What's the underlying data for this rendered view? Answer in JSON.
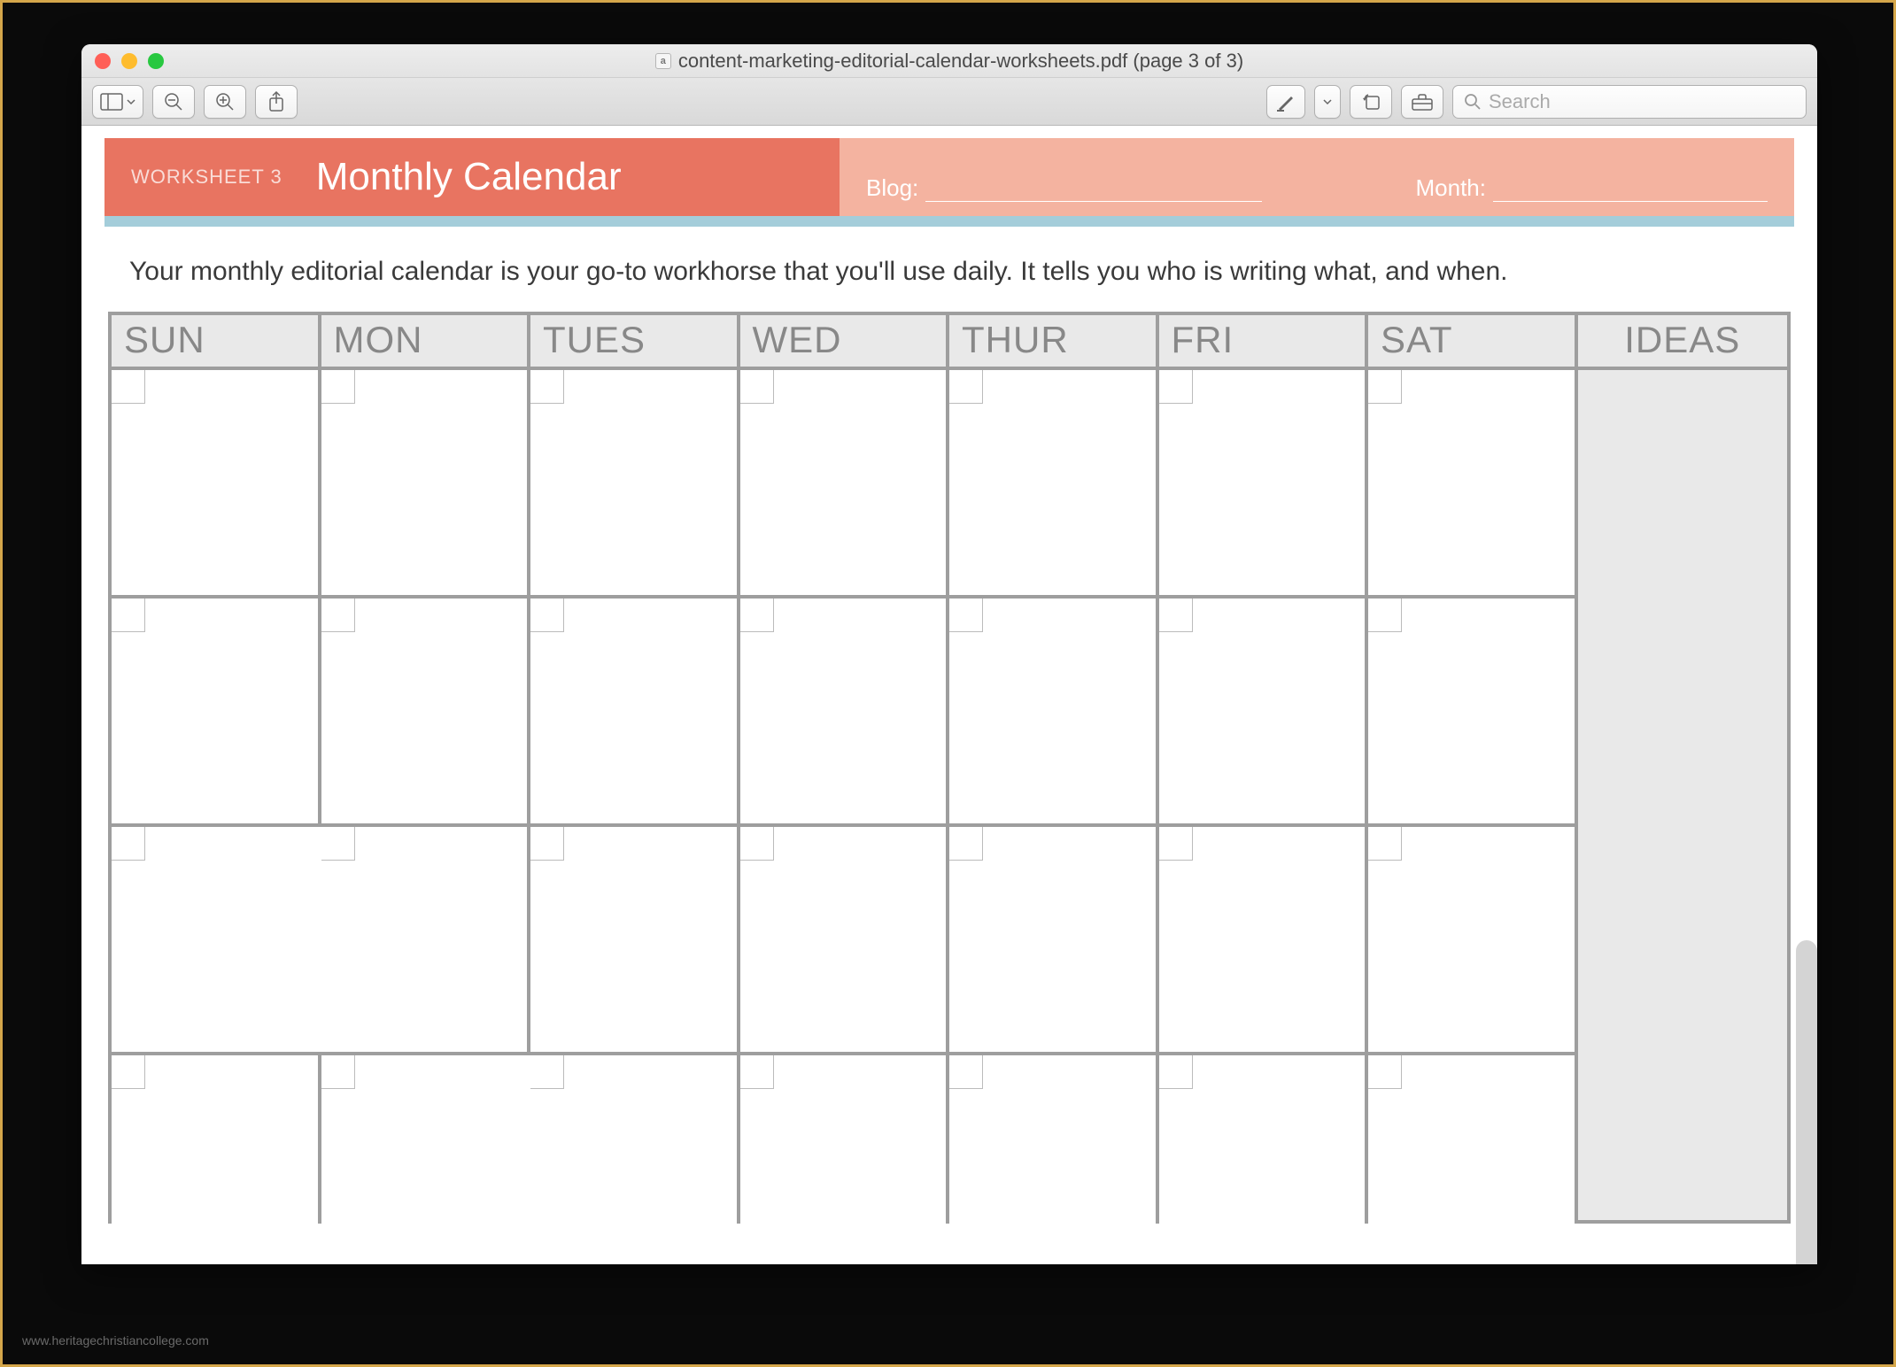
{
  "window": {
    "title": "content-marketing-editorial-calendar-worksheets.pdf (page 3 of 3)"
  },
  "toolbar": {
    "search_placeholder": "Search"
  },
  "document": {
    "worksheet_label": "WORKSHEET 3",
    "title": "Monthly Calendar",
    "blog_label": "Blog:",
    "month_label": "Month:",
    "intro": "Your monthly editorial calendar is your go-to workhorse that you'll use daily. It tells you who is writing what, and when.",
    "days": [
      "SUN",
      "MON",
      "TUES",
      "WED",
      "THUR",
      "FRI",
      "SAT"
    ],
    "ideas_label": "IDEAS"
  },
  "watermark": "www.heritagechristiancollege.com"
}
